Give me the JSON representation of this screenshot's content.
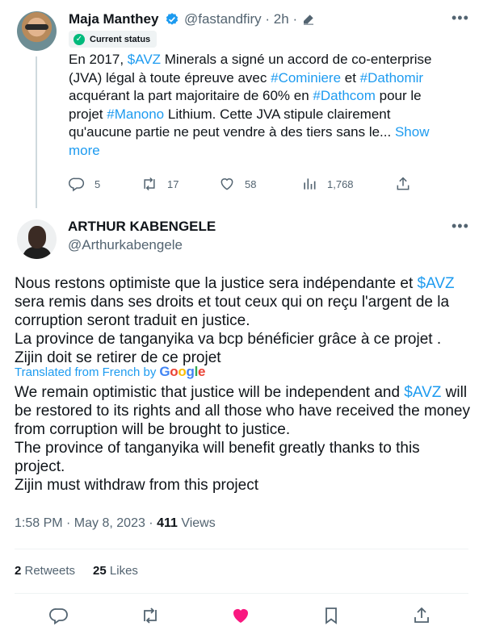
{
  "quoted": {
    "name": "Maja Manthey",
    "handle": "@fastandfiry",
    "time": "· 2h ·",
    "status": "Current status",
    "text": [
      {
        "t": "En 2017, "
      },
      {
        "t": "$AVZ",
        "link": true
      },
      {
        "t": " Minerals a signé un accord de co-enterprise (JVA) légal à toute épreuve avec "
      },
      {
        "t": "#Cominiere",
        "link": true
      },
      {
        "t": " et "
      },
      {
        "t": "#Dathomir",
        "link": true
      },
      {
        "t": " acquérant la part majoritaire de 60% en "
      },
      {
        "t": "#Dathcom",
        "link": true
      },
      {
        "t": " pour le projet "
      },
      {
        "t": "#Manono",
        "link": true
      },
      {
        "t": " Lithium. Cette JVA stipule clairement qu'aucune partie ne peut vendre à des tiers sans le... "
      },
      {
        "t": "Show more",
        "link": true
      }
    ],
    "actions": {
      "replies": "5",
      "retweets": "17",
      "likes": "58",
      "views": "1,768"
    }
  },
  "tweet": {
    "name": "ARTHUR KABENGELE",
    "handle": "@Arthurkabengele",
    "text_fr": [
      {
        "t": "Nous restons optimiste que la justice sera indépendante et "
      },
      {
        "t": "$AVZ",
        "link": true
      },
      {
        "t": " sera remis dans ses droits et tout ceux qui on reçu l'argent de la corruption seront traduit en justice.\nLa province de tanganyika va bcp bénéficier grâce à ce projet .\nZijin doit se retirer de ce projet"
      }
    ],
    "translated_label": "Translated from French by",
    "translator": "Google",
    "text_en": [
      {
        "t": "We remain optimistic that justice will be independent and "
      },
      {
        "t": "$AVZ",
        "link": true
      },
      {
        "t": " will be restored to its rights and all those who have received the money from corruption will be brought to justice.\nThe province of tanganyika will benefit greatly thanks to this project.\nZijin must withdraw from this project"
      }
    ],
    "timestamp": "1:58 PM · May 8, 2023 · ",
    "views_count": "411",
    "views_label": " Views",
    "retweets_count": "2",
    "retweets_label": " Retweets",
    "likes_count": "25",
    "likes_label": " Likes"
  },
  "colors": {
    "link": "#1d9bf0",
    "muted": "#536471",
    "liked": "#f91880",
    "verified": "#1d9bf0",
    "status_check": "#00ba7c"
  },
  "icons": [
    "verified-badge-icon",
    "edit-icon",
    "more-icon",
    "reply-icon",
    "retweet-icon",
    "like-icon",
    "views-icon",
    "share-icon",
    "bookmark-icon"
  ]
}
